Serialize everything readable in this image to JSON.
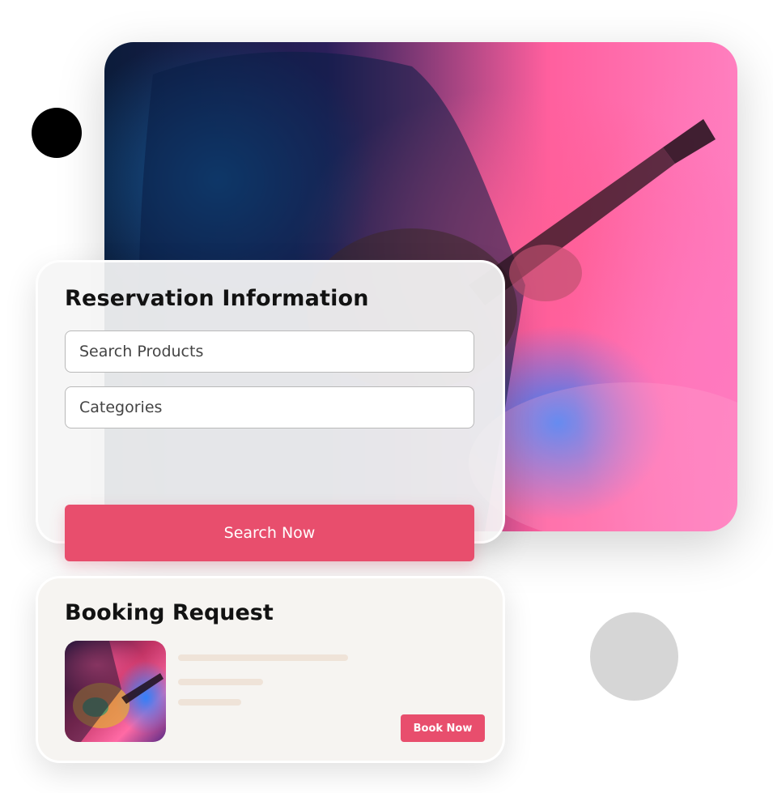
{
  "reservation": {
    "title": "Reservation Information",
    "search_placeholder": "Search Products",
    "categories_placeholder": "Categories",
    "search_button": "Search Now"
  },
  "booking": {
    "title": "Booking Request",
    "book_button": "Book Now"
  },
  "colors": {
    "accent": "#e84e6d",
    "card_bg": "#f6f4f1",
    "placeholder_line": "#efe3d8",
    "decor_dark": "#000000",
    "decor_gray": "#d6d6d6"
  },
  "icons": [
    "concert-photo",
    "guitar-thumbnail"
  ]
}
